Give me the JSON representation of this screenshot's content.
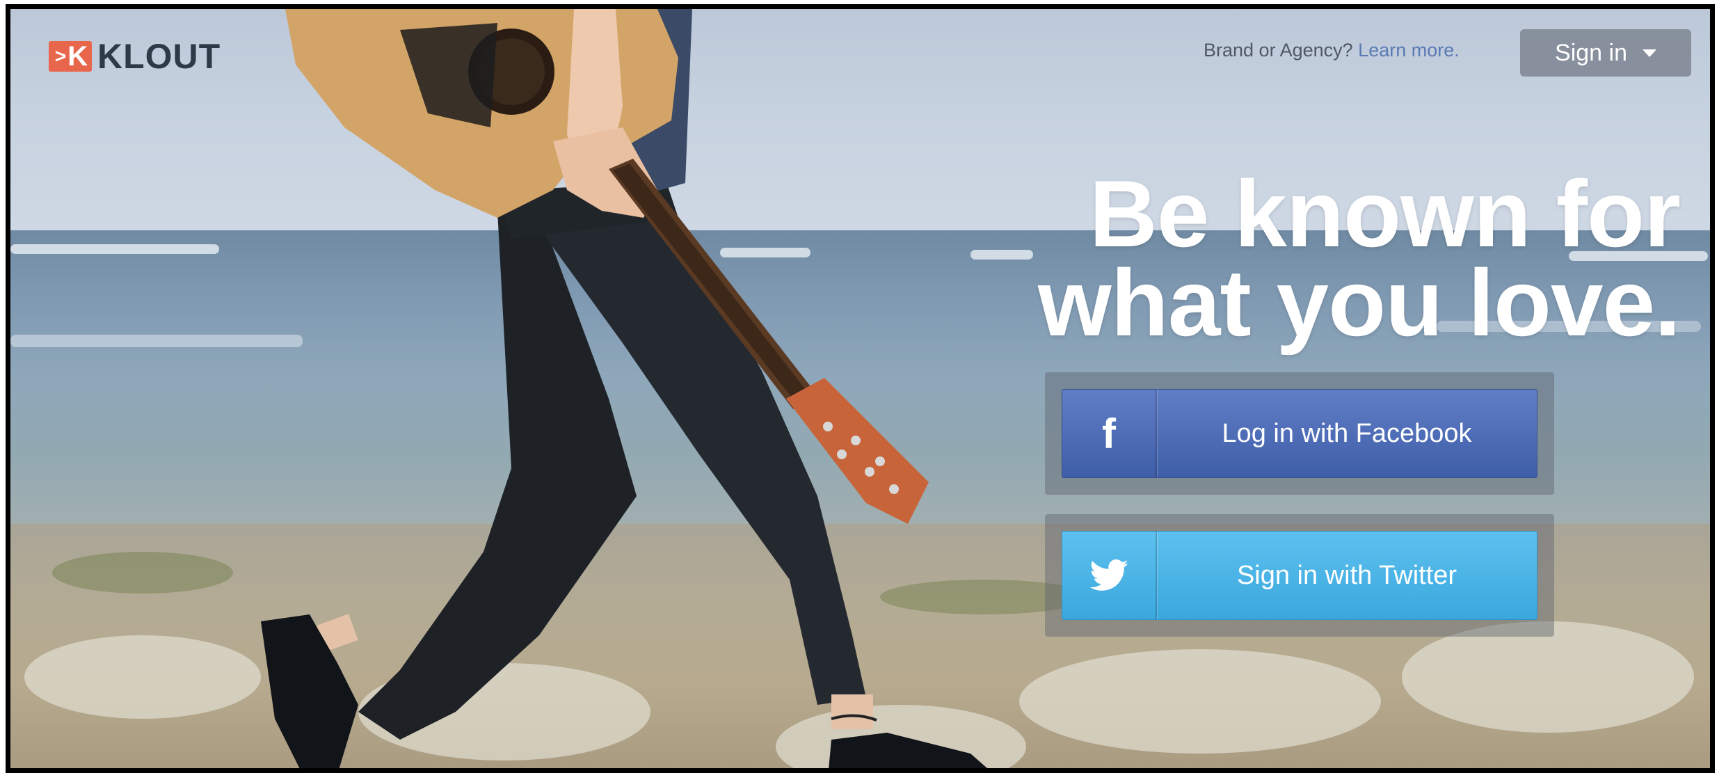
{
  "logo": {
    "mark": "K",
    "text": "KLOUT"
  },
  "header": {
    "brand_question": "Brand or Agency?",
    "learn_more": "Learn more.",
    "signin_label": "Sign in"
  },
  "hero": {
    "headline_line1": "Be known for",
    "headline_line2": "what you love."
  },
  "buttons": {
    "facebook_label": "Log in with Facebook",
    "facebook_icon": "f",
    "twitter_label": "Sign in with Twitter"
  },
  "colors": {
    "brand_orange": "#e8674c",
    "facebook_blue": "#4a67ae",
    "twitter_blue": "#47b2e6",
    "link_blue": "#5a78b3"
  },
  "icons": {
    "facebook": "facebook-icon",
    "twitter": "twitter-bird-icon",
    "dropdown": "chevron-down-icon"
  }
}
